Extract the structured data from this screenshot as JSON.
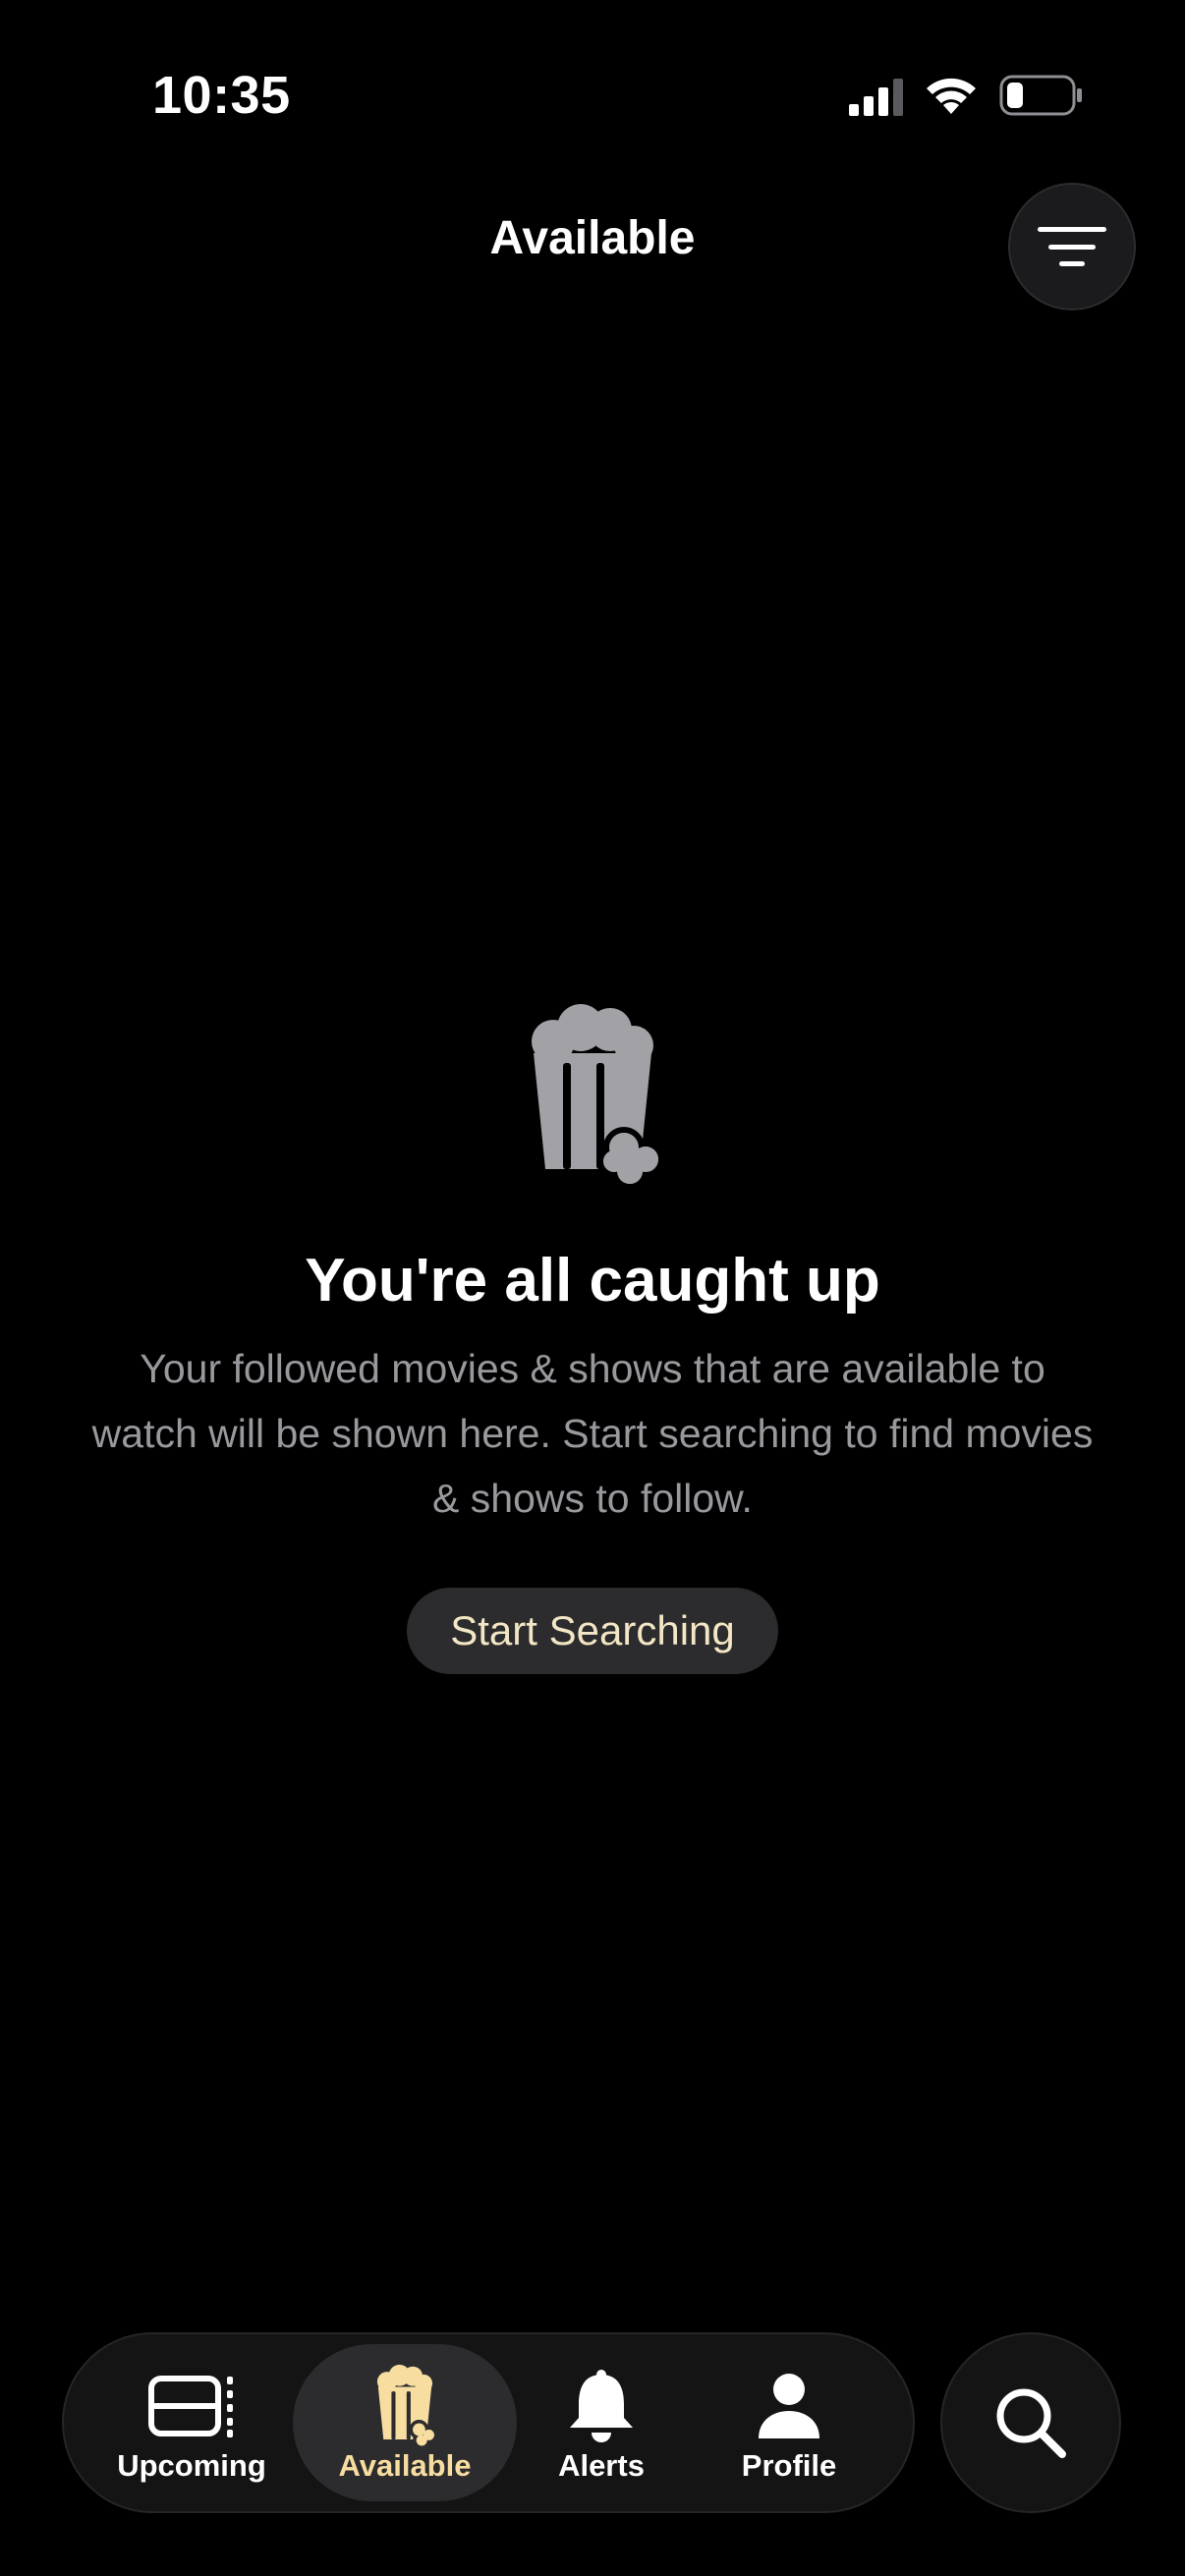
{
  "status_bar": {
    "time": "10:35",
    "icons": [
      "cellular-signal-icon",
      "wifi-icon",
      "battery-icon"
    ]
  },
  "header": {
    "title": "Available",
    "filter_icon": "filter-lines-icon"
  },
  "empty_state": {
    "icon": "popcorn-icon",
    "title": "You're all caught up",
    "body": "Your followed movies & shows that are available to watch will be shown here. Start searching to find movies & shows to follow.",
    "button_label": "Start Searching"
  },
  "tab_bar": {
    "tabs": [
      {
        "label": "Upcoming",
        "icon": "calendar-stack-icon",
        "active": false
      },
      {
        "label": "Available",
        "icon": "popcorn-icon",
        "active": true
      },
      {
        "label": "Alerts",
        "icon": "bell-icon",
        "active": false
      },
      {
        "label": "Profile",
        "icon": "person-icon",
        "active": false
      }
    ],
    "search_icon": "search-icon"
  },
  "colors": {
    "background": "#000000",
    "accent": "#F7DEA0",
    "muted_text": "#98989D",
    "surface": "#141414",
    "active_surface": "#2C2C2E"
  }
}
